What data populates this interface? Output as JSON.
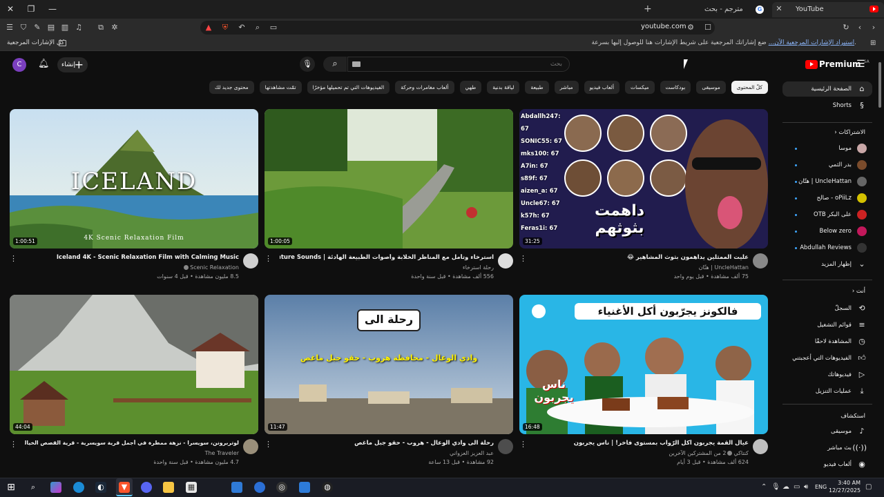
{
  "browser": {
    "tabs": [
      {
        "label": "YouTube",
        "active": true
      },
      {
        "label": "مترجم - بحث Google",
        "active": false
      }
    ],
    "url": "youtube.com",
    "bookmarks_bar": {
      "all_bookmarks_label": "كل الإشارات المرجعية",
      "hint_text": "ضع إشاراتك المرجعية على شريط الإشارات هنا للوصول إليها بسرعة.",
      "import_link": "استيراد الإشارات المرجعية الآن..."
    }
  },
  "youtube": {
    "logo_text": "Premium",
    "logo_region": "SA",
    "avatar_letter": "C",
    "create_label": "إنشاء",
    "search_placeholder": "بحث",
    "chips": [
      {
        "label": "كلّ المحتوى",
        "active": true
      },
      {
        "label": "موسيقى",
        "active": false
      },
      {
        "label": "بودكاست",
        "active": false
      },
      {
        "label": "ميكسات",
        "active": false
      },
      {
        "label": "ألعاب فيديو",
        "active": false
      },
      {
        "label": "مباشر",
        "active": false
      },
      {
        "label": "طبيعة",
        "active": false
      },
      {
        "label": "لياقة بدنية",
        "active": false
      },
      {
        "label": "طهي",
        "active": false
      },
      {
        "label": "ألعاب مغامرات وحركة",
        "active": false
      },
      {
        "label": "الفيديوهات التي تم تحميلها مؤخرًا",
        "active": false
      },
      {
        "label": "تمّت مشاهدتها",
        "active": false
      },
      {
        "label": "محتوى جديد لك",
        "active": false
      }
    ],
    "sidebar": {
      "main": [
        {
          "label": "الصفحة الرئيسية",
          "icon": "home-icon",
          "active": true
        },
        {
          "label": "Shorts",
          "icon": "shorts-icon",
          "active": false
        }
      ],
      "subscriptions_title": "الاشتراكات",
      "subscriptions": [
        {
          "label": "موسا",
          "color": "#c9a7a7"
        },
        {
          "label": "بدر الثمي",
          "color": "#7a4b2b"
        },
        {
          "label": "UncleHattan | هتّان",
          "color": "#666666"
        },
        {
          "label": "oPiiLz - صالح",
          "color": "#d4c100"
        },
        {
          "label": "على البكر OTB",
          "color": "#cc2222"
        },
        {
          "label": "Below zero",
          "color": "#c2185b"
        },
        {
          "label": "Abdullah Reviews",
          "color": "#333333"
        }
      ],
      "show_more_label": "إظهار المزيد",
      "you_title": "أنت",
      "you_items": [
        {
          "label": "السجلّ",
          "icon": "history-icon"
        },
        {
          "label": "قوائم التشغيل",
          "icon": "playlist-icon"
        },
        {
          "label": "المشاهدة لاحقًا",
          "icon": "watch-later-icon"
        },
        {
          "label": "الفيديوهات التي أعجبتني",
          "icon": "like-icon"
        },
        {
          "label": "فيديوهاتك",
          "icon": "your-videos-icon"
        },
        {
          "label": "عمليات التنزيل",
          "icon": "download-icon"
        }
      ],
      "explore_title": "استكشاف",
      "explore_items": [
        {
          "label": "موسيقى",
          "icon": "music-icon"
        },
        {
          "label": "بث مباشر",
          "icon": "live-icon"
        },
        {
          "label": "ألعاب فيديو",
          "icon": "gaming-icon"
        }
      ]
    },
    "videos": [
      {
        "title": "Iceland 4K - Scenic Relaxation Film with Calming Music",
        "channel": "Scenic Relaxation",
        "verified": true,
        "meta": "8.5 مليون مشاهدة • قبل 4 سنوات",
        "duration": "1:00:51",
        "thumb_text": "ICELAND",
        "thumb_sub": "4K Scenic Relaxation Film"
      },
      {
        "title": "استرخاء وتأمل مع المناظر الخلابة وأصوات الطبيعة الهادئة | Calming Nature Sounds",
        "channel": "رحلة استرخاء",
        "verified": false,
        "meta": "556 ألف مشاهدة • قبل سنة واحدة",
        "duration": "1:00:05"
      },
      {
        "title": "عليت الممثلين يداهمون بثوث المشاهير 😂",
        "channel": "UncleHattan | هتّان",
        "verified": false,
        "meta": "75 ألف مشاهدة • قبل يوم واحد",
        "duration": "31:25",
        "thumb_text": "داهمت بثوثهم",
        "chat": [
          "Abdallh247: 67",
          "SONIC55: 67",
          "mks100: 67",
          "A7in: 67",
          "s89f: 67",
          "aizen_a: 67",
          "Uncle67: 67",
          "k57h: 67",
          "Feras1i: 67"
        ]
      },
      {
        "title": "لوتربرونن، سويسرا - نزهة ممطرة في أجمل قرية سويسرية - قرية القصص الخيالية",
        "channel": "The Traveler",
        "verified": false,
        "meta": "4.7 مليون مشاهدة • قبل سنة واحدة",
        "duration": "44:04"
      },
      {
        "title": "رحلة الى وادي الوعال - هروب - حقو جبل ماغص",
        "channel": "عبد العزيز العزواني",
        "verified": false,
        "meta": "92 مشاهدة • قبل 13 ساعة",
        "duration": "11:47",
        "thumb_text": "رحلة الى",
        "thumb_sub": "وادي الوعال - محافظة هروب - حقو جبل ماغص"
      },
      {
        "title": "عيال القمة يجربون أكل الرّواب بمستوى فاخر! | ناس يجربون",
        "channel": "كنتاكي",
        "channel_extra": "2 من المشتركين الآخرين",
        "verified": true,
        "meta": "624 ألف مشاهدة • قبل 3 أيام",
        "duration": "16:48",
        "thumb_text": "فالكونز يجرّبون أكل الأغنياء",
        "thumb_sub": "ناس يجربون"
      }
    ]
  },
  "taskbar": {
    "lang": "ENG",
    "time": "3:40 AM",
    "date": "12/27/2025"
  }
}
